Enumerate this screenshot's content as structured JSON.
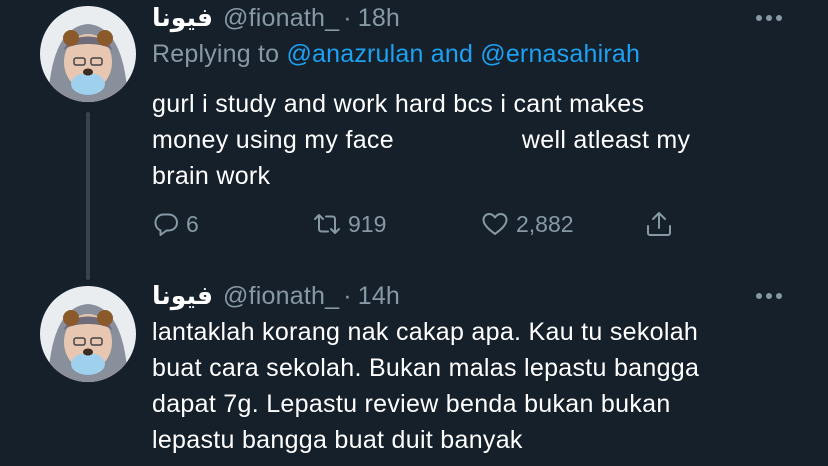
{
  "tweets": [
    {
      "display_name": "فيونا",
      "handle": "@fionath_",
      "separator": "·",
      "time": "18h",
      "replying_prefix": "Replying to",
      "replying_mention_1": "@anazrulan",
      "replying_and": "and",
      "replying_mention_2": "@ernasahirah",
      "body_lines": [
        "gurl i study and work hard bcs i cant makes",
        "money using my face",
        "well atleast my",
        "brain work"
      ],
      "stats": {
        "replies": "6",
        "retweets": "919",
        "likes": "2,882"
      }
    },
    {
      "display_name": "فيونا",
      "handle": "@fionath_",
      "separator": "·",
      "time": "14h",
      "body_lines": [
        "lantaklah korang nak cakap apa. Kau tu sekolah",
        "buat cara sekolah. Bukan malas lepastu bangga",
        "dapat 7g. Lepastu review benda bukan bukan",
        "lepastu bangga buat duit banyak"
      ]
    }
  ],
  "icons": {
    "more": "more-horizontal-icon",
    "reply": "reply-bubble-icon",
    "retweet": "retweet-icon",
    "like": "heart-icon",
    "share": "share-icon"
  },
  "colors": {
    "background": "#15202b",
    "text": "#ffffff",
    "secondary": "#8899a6",
    "link": "#1da1f2",
    "thread_line": "#38444d"
  }
}
